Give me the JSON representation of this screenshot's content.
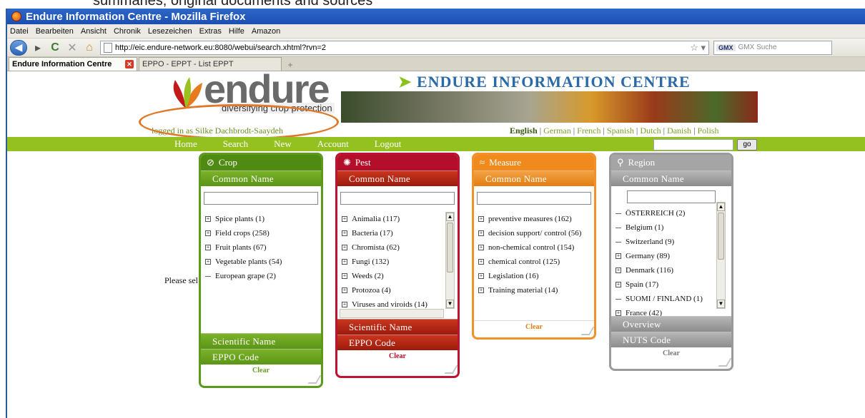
{
  "slide_caption": "summaries, original documents and sources",
  "window": {
    "title": "Endure Information Centre - Mozilla Firefox"
  },
  "menubar": [
    "Datei",
    "Bearbeiten",
    "Ansicht",
    "Chronik",
    "Lesezeichen",
    "Extras",
    "Hilfe",
    "Amazon"
  ],
  "url": "http://eic.endure-network.eu:8080/webui/search.xhtml?rvn=2",
  "search_engine": {
    "logo": "GMX",
    "placeholder": "GMX Suche"
  },
  "tabs": [
    {
      "label": "Endure Information Centre"
    },
    {
      "label": "EPPO - EPPT - List EPPT"
    }
  ],
  "site": {
    "logo": "endure",
    "tagline": "diversifying crop protection",
    "title": "ENDURE INFORMATION CENTRE",
    "logged_in": "logged in as Silke Dachbrodt-Saaydeh",
    "languages": [
      "English",
      "German",
      "French",
      "Spanish",
      "Dutch",
      "Danish",
      "Polish"
    ],
    "selected_language": "English",
    "nav": [
      "Home",
      "Search",
      "New",
      "Account",
      "Logout"
    ],
    "go_label": "go",
    "please_select": "Please sel"
  },
  "panels": {
    "crop": {
      "title": "Crop",
      "common": "Common Name",
      "items": [
        {
          "label": "Spice plants (1)",
          "expandable": true
        },
        {
          "label": "Field crops (258)",
          "expandable": true
        },
        {
          "label": "Fruit plants (67)",
          "expandable": true
        },
        {
          "label": "Vegetable plants (54)",
          "expandable": true
        },
        {
          "label": "European grape (2)",
          "expandable": false
        }
      ],
      "scientific": "Scientific Name",
      "eppo": "EPPO Code",
      "clear": "Clear"
    },
    "pest": {
      "title": "Pest",
      "common": "Common Name",
      "items": [
        {
          "label": "Animalia (117)",
          "expandable": true
        },
        {
          "label": "Bacteria (17)",
          "expandable": true
        },
        {
          "label": "Chromista (62)",
          "expandable": true
        },
        {
          "label": "Fungi (132)",
          "expandable": true
        },
        {
          "label": "Weeds (2)",
          "expandable": true
        },
        {
          "label": "Protozoa (4)",
          "expandable": true
        },
        {
          "label": "Viruses and viroids (14)",
          "expandable": true
        }
      ],
      "scientific": "Scientific Name",
      "eppo": "EPPO Code",
      "clear": "Clear"
    },
    "measure": {
      "title": "Measure",
      "common": "Common Name",
      "items": [
        {
          "label": "preventive measures (162)",
          "expandable": true
        },
        {
          "label": "decision support/ control (56)",
          "expandable": true
        },
        {
          "label": "non-chemical control (154)",
          "expandable": true
        },
        {
          "label": "chemical control (125)",
          "expandable": true
        },
        {
          "label": "Legislation (16)",
          "expandable": true
        },
        {
          "label": "Training material (14)",
          "expandable": true
        }
      ],
      "clear": "Clear"
    },
    "region": {
      "title": "Region",
      "common": "Common Name",
      "items": [
        {
          "label": "ÖSTERREICH (2)",
          "expandable": false
        },
        {
          "label": "Belgium (1)",
          "expandable": false
        },
        {
          "label": "Switzerland (9)",
          "expandable": false
        },
        {
          "label": "Germany (89)",
          "expandable": true
        },
        {
          "label": "Denmark (116)",
          "expandable": true
        },
        {
          "label": "Spain (17)",
          "expandable": true
        },
        {
          "label": "SUOMI / FINLAND (1)",
          "expandable": false
        },
        {
          "label": "France (42)",
          "expandable": true
        }
      ],
      "overview": "Overview",
      "nuts": "NUTS Code",
      "clear": "Clear"
    }
  }
}
